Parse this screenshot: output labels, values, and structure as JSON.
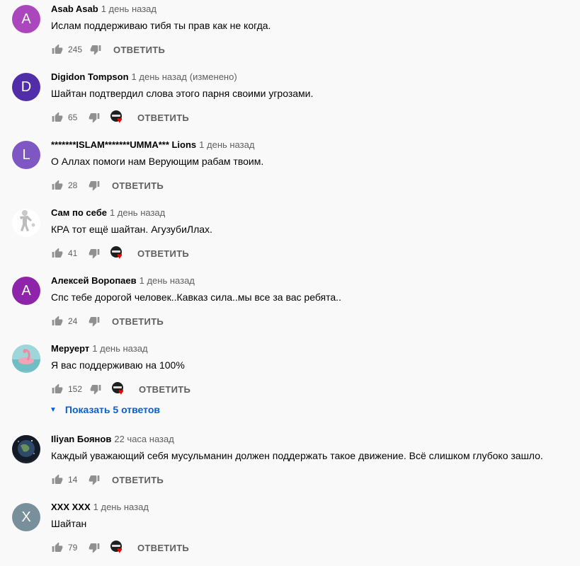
{
  "reply_label": "ОТВЕТИТЬ",
  "show_replies": {
    "label": "Показать 5 ответов",
    "color": "#065fd4"
  },
  "comments": [
    {
      "author": "Asab Asab",
      "time": "1 день назад",
      "edited": "",
      "text": "Ислам поддерживаю тибя ты прав как не когда.",
      "likes": "245",
      "avatar_letter": "A",
      "avatar_color": "#ab47bc",
      "creator_heart": false
    },
    {
      "author": "Digidon Tompson",
      "time": "1 день назад",
      "edited": "(изменено)",
      "text": "Шайтан подтвердил слова этого парня своими угрозами.",
      "likes": "65",
      "avatar_letter": "D",
      "avatar_color": "#512da8",
      "creator_heart": true
    },
    {
      "author": "*******ISLAM*******UMMA*** Lions",
      "time": "1 день назад",
      "edited": "",
      "text": "О Аллах помоги нам Верующим рабам твоим.",
      "likes": "28",
      "avatar_letter": "L",
      "avatar_color": "#7e57c2",
      "creator_heart": false
    },
    {
      "author": "Сам по себе",
      "time": "1 день назад",
      "edited": "",
      "text": "КРА тот ещё шайтан. АгузубиЛлах.",
      "likes": "41",
      "avatar_letter": "",
      "avatar_color": "#ffffff",
      "avatar_icon": "figure-avatar-icon",
      "creator_heart": true
    },
    {
      "author": "Алексей Воропаев",
      "time": "1 день назад",
      "edited": "",
      "text": "Спс тебе дорогой человек..Кавказ сила..мы все за вас ребята..",
      "likes": "24",
      "avatar_letter": "A",
      "avatar_color": "#8e24aa",
      "creator_heart": false
    },
    {
      "author": "Меруерт",
      "time": "1 день назад",
      "edited": "",
      "text": "Я вас поддерживаю на 100%",
      "likes": "152",
      "avatar_letter": "",
      "avatar_color": "#7fc3c9",
      "avatar_icon": "flamingo-avatar-icon",
      "creator_heart": true
    },
    {
      "author": "Iliyan Боянов",
      "time": "22 часа назад",
      "edited": "",
      "text": "Каждый уважающий себя мусульманин должен поддержать такое движение. Всё слишком глубоко зашло.",
      "likes": "14",
      "avatar_letter": "",
      "avatar_color": "#1b2331",
      "avatar_icon": "earth-avatar-icon",
      "creator_heart": false
    },
    {
      "author": "XXX XXX",
      "time": "1 день назад",
      "edited": "",
      "text": "Шайтан",
      "likes": "79",
      "avatar_letter": "X",
      "avatar_color": "#78909c",
      "creator_heart": true
    }
  ]
}
